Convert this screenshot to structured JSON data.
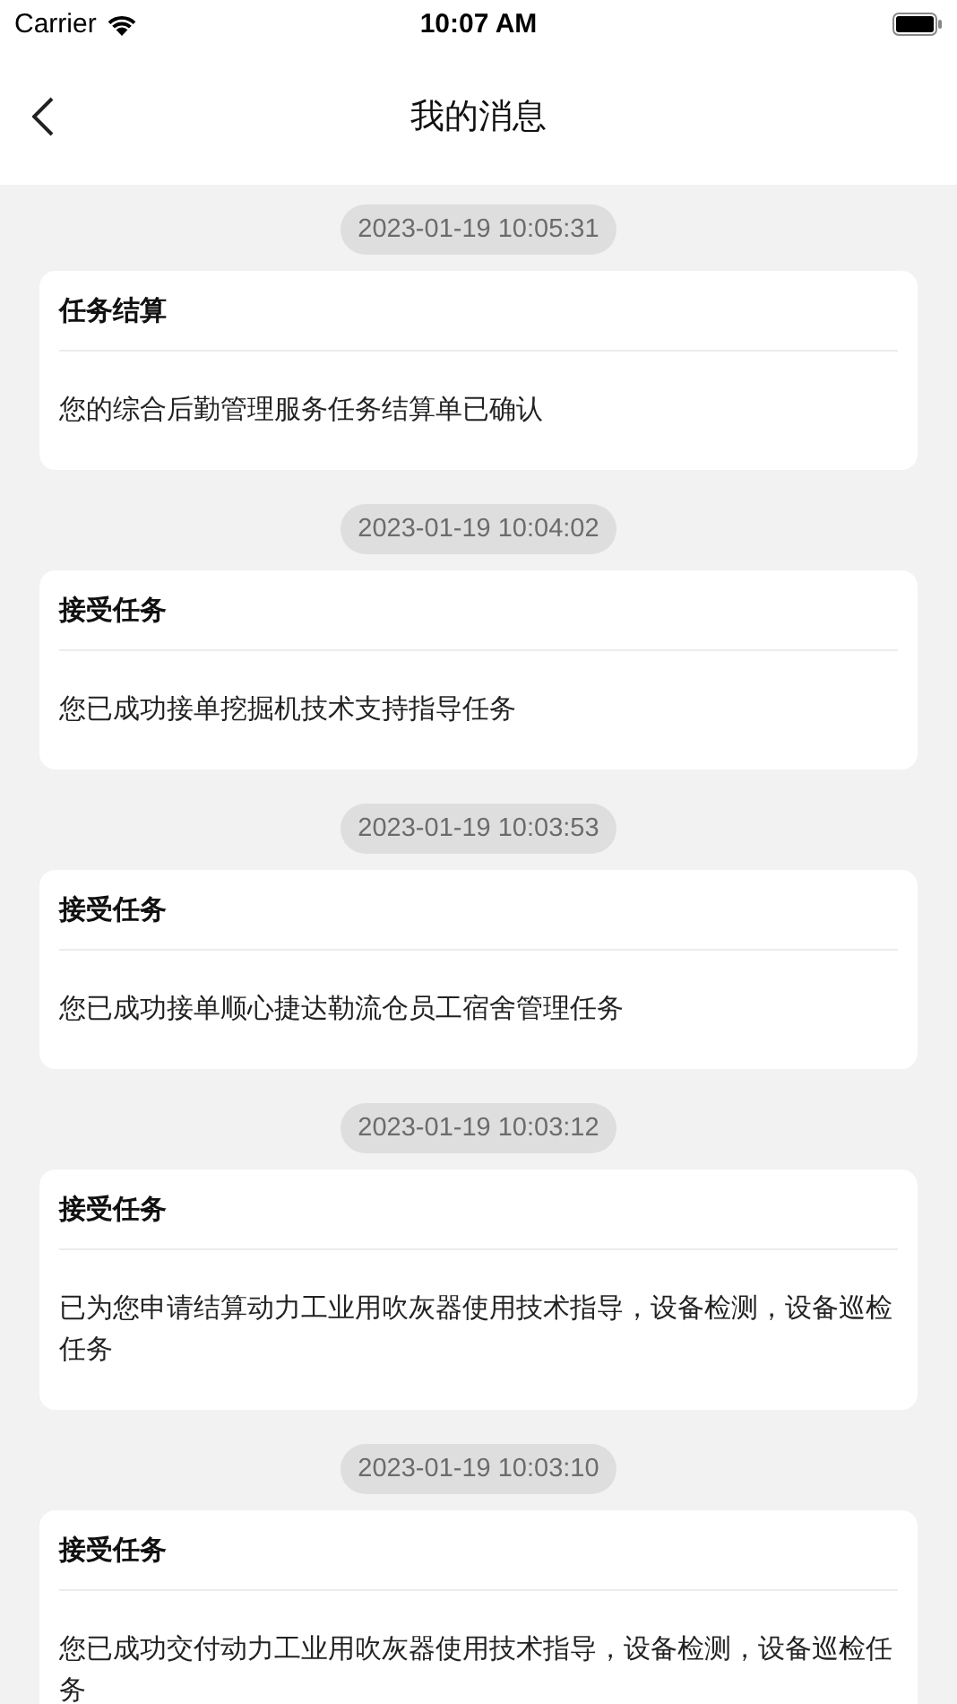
{
  "status_bar": {
    "carrier": "Carrier",
    "time": "10:07 AM"
  },
  "nav": {
    "title": "我的消息"
  },
  "messages": [
    {
      "time": "2023-01-19 10:05:31",
      "title": "任务结算",
      "body": "您的综合后勤管理服务任务结算单已确认"
    },
    {
      "time": "2023-01-19 10:04:02",
      "title": "接受任务",
      "body": "您已成功接单挖掘机技术支持指导任务"
    },
    {
      "time": "2023-01-19 10:03:53",
      "title": "接受任务",
      "body": "您已成功接单顺心捷达勒流仓员工宿舍管理任务"
    },
    {
      "time": "2023-01-19 10:03:12",
      "title": "接受任务",
      "body": "已为您申请结算动力工业用吹灰器使用技术指导，设备检测，设备巡检任务"
    },
    {
      "time": "2023-01-19 10:03:10",
      "title": "接受任务",
      "body": "您已成功交付动力工业用吹灰器使用技术指导，设备检测，设备巡检任务"
    }
  ]
}
